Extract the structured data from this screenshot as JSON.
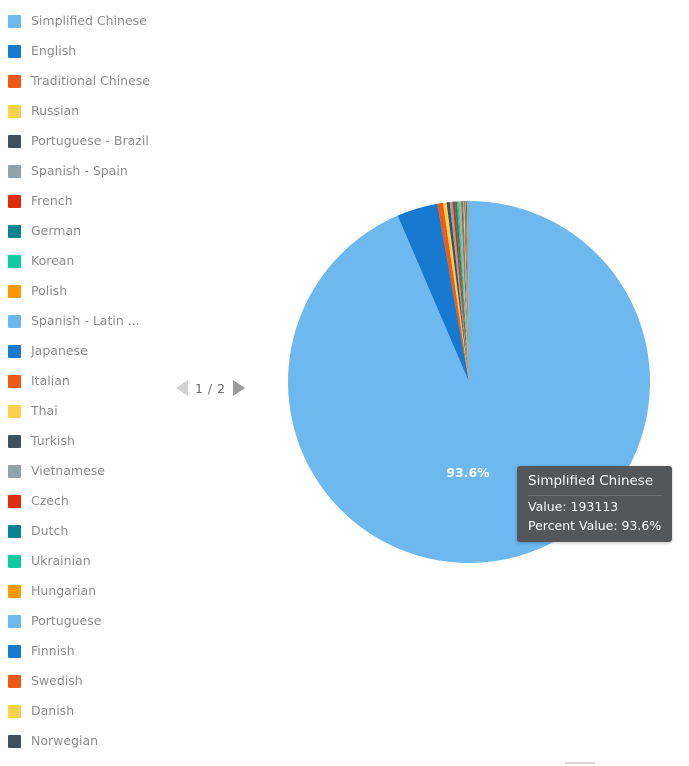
{
  "chart_data": {
    "type": "pie",
    "title": "",
    "legend_position": "left",
    "grid": false,
    "categories": [
      "Simplified Chinese",
      "English",
      "Traditional Chinese",
      "Russian",
      "Portuguese - Brazil",
      "Spanish - Spain",
      "French",
      "German",
      "Korean",
      "Polish",
      "Spanish - Latin ...",
      "Japanese",
      "Italian",
      "Thai",
      "Turkish",
      "Vietnamese",
      "Czech",
      "Dutch",
      "Ukrainian",
      "Hungarian",
      "Portuguese",
      "Finnish",
      "Swedish",
      "Danish",
      "Norwegian"
    ],
    "values": [
      93.6,
      3.65,
      0.5,
      0.32,
      0.28,
      0.24,
      0.21,
      0.18,
      0.15,
      0.13,
      0.11,
      0.1,
      0.09,
      0.08,
      0.07,
      0.06,
      0.05,
      0.045,
      0.04,
      0.035,
      0.03,
      0.026,
      0.022,
      0.018,
      0.014
    ],
    "unit": "percent",
    "labeled_slices": [
      {
        "category": "Simplified Chinese",
        "label": "93.6%",
        "value": 193113,
        "percent": 93.6
      }
    ],
    "colors": [
      "#6cb8ef",
      "#1879d1",
      "#f15a16",
      "#fbd14c",
      "#3d525c",
      "#93a2a8",
      "#e02c0b",
      "#088491",
      "#0ecb9d",
      "#fc9a06",
      "#6cb8ef",
      "#1879d1",
      "#f15a16",
      "#fbd14c",
      "#3d525c",
      "#93a2a8",
      "#e02c0b",
      "#088491",
      "#0ecb9d",
      "#fc9a06",
      "#6cb8ef",
      "#1879d1",
      "#f15a16",
      "#fbd14c",
      "#3d525c"
    ]
  },
  "legend": {
    "items": [
      {
        "label": "Simplified Chinese",
        "color": "#6cb8ef"
      },
      {
        "label": "English",
        "color": "#1879d1"
      },
      {
        "label": "Traditional Chinese",
        "color": "#f15a16"
      },
      {
        "label": "Russian",
        "color": "#fbd14c"
      },
      {
        "label": "Portuguese - Brazil",
        "color": "#3d525c"
      },
      {
        "label": "Spanish - Spain",
        "color": "#93a2a8"
      },
      {
        "label": "French",
        "color": "#e02c0b"
      },
      {
        "label": "German",
        "color": "#088491"
      },
      {
        "label": "Korean",
        "color": "#0ecb9d"
      },
      {
        "label": "Polish",
        "color": "#fc9a06"
      },
      {
        "label": "Spanish - Latin ...",
        "color": "#6cb8ef"
      },
      {
        "label": "Japanese",
        "color": "#1879d1"
      },
      {
        "label": "Italian",
        "color": "#f15a16"
      },
      {
        "label": "Thai",
        "color": "#fbd14c"
      },
      {
        "label": "Turkish",
        "color": "#3d525c"
      },
      {
        "label": "Vietnamese",
        "color": "#93a2a8"
      },
      {
        "label": "Czech",
        "color": "#e02c0b"
      },
      {
        "label": "Dutch",
        "color": "#088491"
      },
      {
        "label": "Ukrainian",
        "color": "#0ecb9d"
      },
      {
        "label": "Hungarian",
        "color": "#fc9a06"
      },
      {
        "label": "Portuguese",
        "color": "#6cb8ef"
      },
      {
        "label": "Finnish",
        "color": "#1879d1"
      },
      {
        "label": "Swedish",
        "color": "#f15a16"
      },
      {
        "label": "Danish",
        "color": "#fbd14c"
      },
      {
        "label": "Norwegian",
        "color": "#3d525c"
      }
    ]
  },
  "pager": {
    "text": "1 / 2",
    "current_page": 1,
    "total_pages": 2,
    "prev_icon": "triangle-left-icon",
    "next_icon": "triangle-right-icon",
    "prev_enabled": false,
    "next_enabled": true
  },
  "tooltip": {
    "title": "Simplified Chinese",
    "value_line": "Value:  193113",
    "percent_line": "Percent Value: 93.6%"
  }
}
